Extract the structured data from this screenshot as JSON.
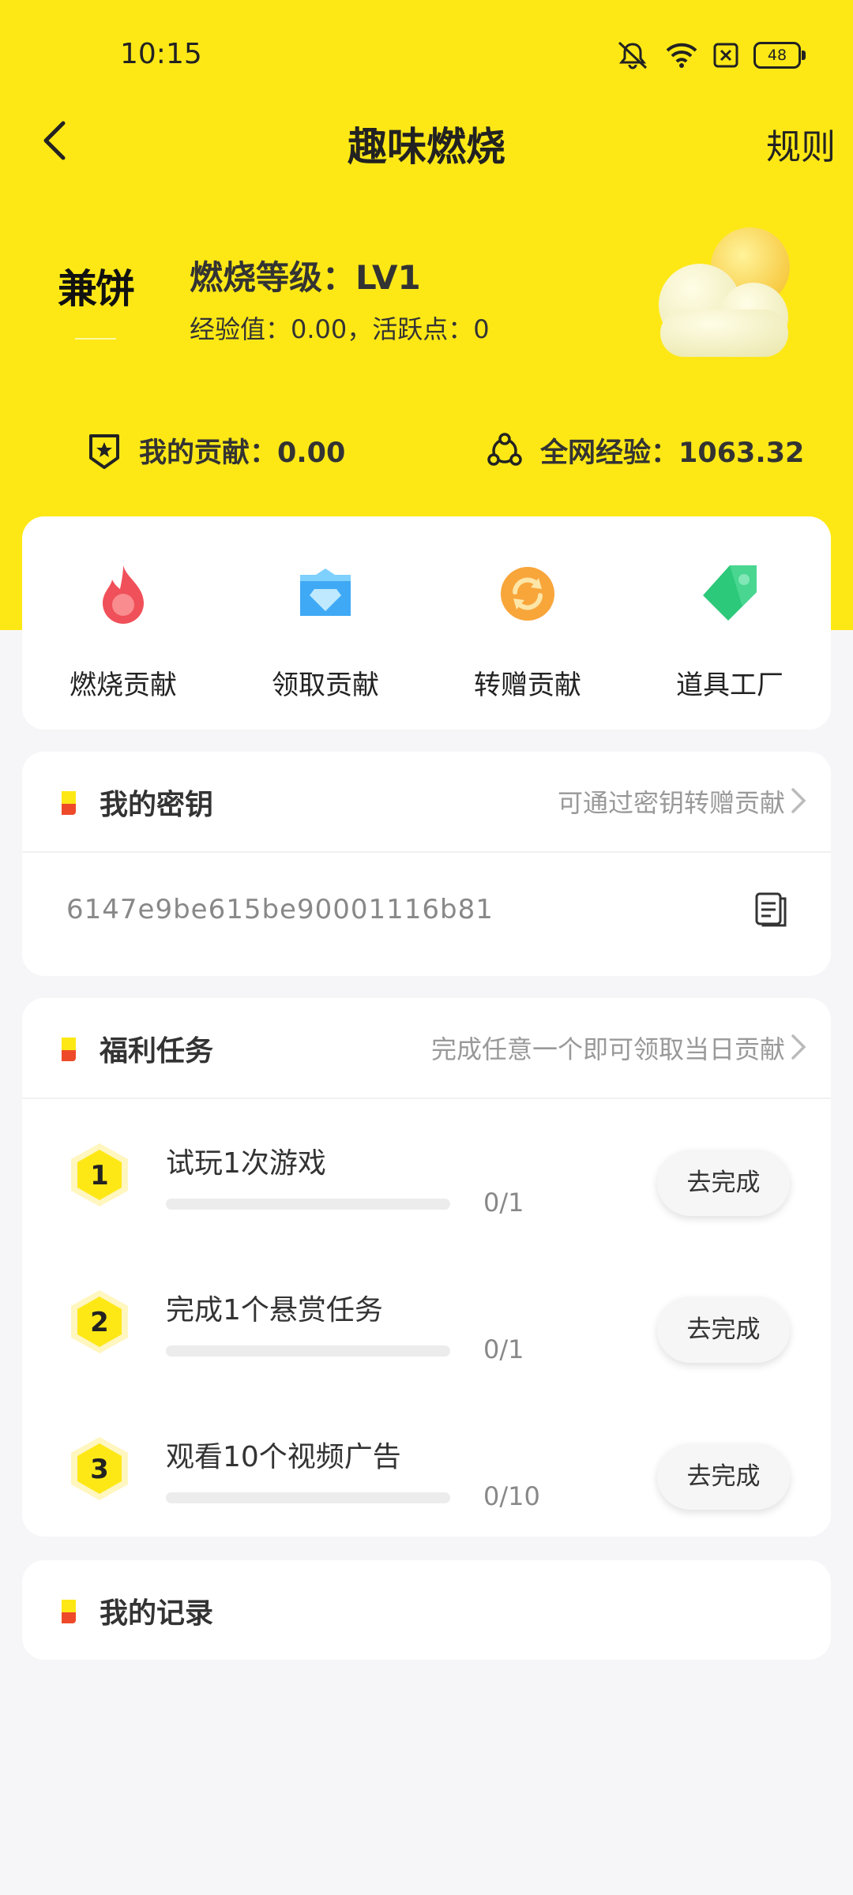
{
  "status": {
    "time": "10:15",
    "battery": "48"
  },
  "nav": {
    "title": "趣味燃烧",
    "rules": "规则"
  },
  "profile": {
    "brand": "兼饼",
    "level": "燃烧等级：LV1",
    "sub": "经验值：0.00，活跃点：0"
  },
  "stats": {
    "my_contribution": "我的贡献：0.00",
    "network_experience": "全网经验：1063.32"
  },
  "actions": [
    {
      "label": "燃烧贡献",
      "icon": "flame-icon",
      "color": "#f0505a"
    },
    {
      "label": "领取贡献",
      "icon": "diamond-icon",
      "color": "#3fa9f5"
    },
    {
      "label": "转赠贡献",
      "icon": "transfer-icon",
      "color": "#f8a53a"
    },
    {
      "label": "道具工厂",
      "icon": "tag-icon",
      "color": "#2cc97a"
    }
  ],
  "key_section": {
    "title": "我的密钥",
    "hint": "可通过密钥转赠贡献",
    "value": "6147e9be615be90001116b81"
  },
  "tasks_section": {
    "title": "福利任务",
    "hint": "完成任意一个即可领取当日贡献",
    "items": [
      {
        "num": "1",
        "title": "试玩1次游戏",
        "count": "0/1",
        "progress": 0,
        "button": "去完成"
      },
      {
        "num": "2",
        "title": "完成1个悬赏任务",
        "count": "0/1",
        "progress": 0,
        "button": "去完成"
      },
      {
        "num": "3",
        "title": "观看10个视频广告",
        "count": "0/10",
        "progress": 0,
        "button": "去完成"
      }
    ]
  },
  "records_section": {
    "title": "我的记录"
  },
  "colors": {
    "brand_yellow": "#fde816",
    "accent_red": "#ee4a2a"
  }
}
